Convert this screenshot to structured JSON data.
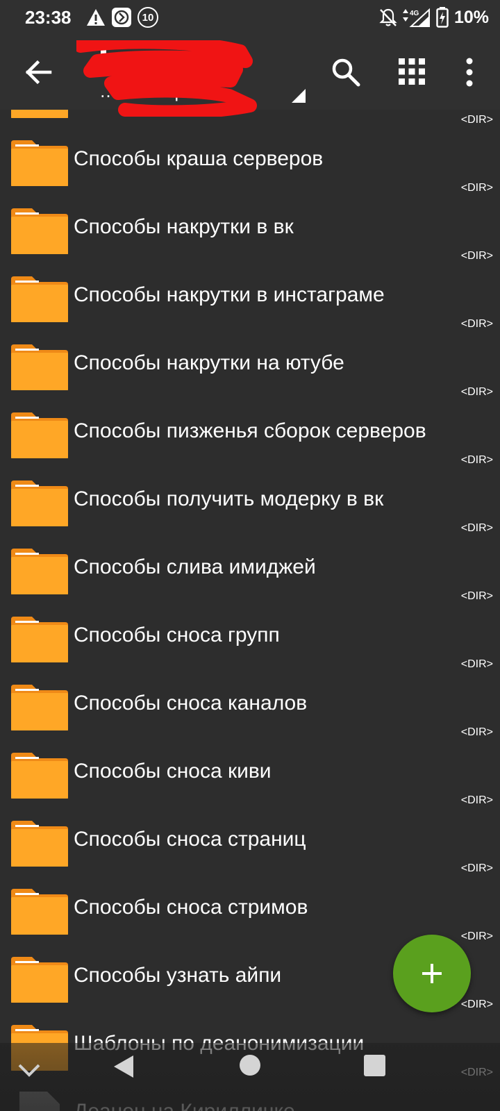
{
  "status_bar": {
    "time": "23:38",
    "battery_percent": "10%",
    "notification_count": "10",
    "network": "4G",
    "left_icons": [
      "warning-icon",
      "app-notification-icon",
      "badge-10-icon"
    ],
    "right_icons": [
      "bell-muted-icon",
      "signal-4g-icon",
      "battery-charging-icon"
    ]
  },
  "app_bar": {
    "subtitle": "…0/            ca.zip",
    "icons": [
      "back-arrow-icon",
      "search-icon",
      "grid-view-icon",
      "more-vertical-icon"
    ]
  },
  "folder_color": "#ffa726",
  "fab_color": "#5aa01e",
  "dir_tag": "<DIR>",
  "items": [
    {
      "name": "",
      "type": "folder",
      "tag": "<DIR>"
    },
    {
      "name": "Способы краша серверов",
      "type": "folder",
      "tag": "<DIR>"
    },
    {
      "name": "Способы накрутки в вк",
      "type": "folder",
      "tag": "<DIR>"
    },
    {
      "name": "Способы накрутки в инстаграме",
      "type": "folder",
      "tag": "<DIR>"
    },
    {
      "name": "Способы накрутки на ютубе",
      "type": "folder",
      "tag": "<DIR>"
    },
    {
      "name": "Способы пизженья сборок серверов",
      "type": "folder",
      "tag": "<DIR>"
    },
    {
      "name": "Способы получить модерку в вк",
      "type": "folder",
      "tag": "<DIR>"
    },
    {
      "name": "Способы слива имиджей",
      "type": "folder",
      "tag": "<DIR>"
    },
    {
      "name": "Способы сноса групп",
      "type": "folder",
      "tag": "<DIR>"
    },
    {
      "name": "Способы сноса каналов",
      "type": "folder",
      "tag": "<DIR>"
    },
    {
      "name": "Способы сноса киви",
      "type": "folder",
      "tag": "<DIR>"
    },
    {
      "name": "Способы сноса страниц",
      "type": "folder",
      "tag": "<DIR>"
    },
    {
      "name": "Способы сноса стримов",
      "type": "folder",
      "tag": "<DIR>"
    },
    {
      "name": "Способы узнать айпи",
      "type": "folder",
      "tag": "<DIR>"
    },
    {
      "name": "Шаблоны по деанонимизации",
      "type": "folder",
      "tag": "<DIR>"
    },
    {
      "name": "Деанон на Кирилличке",
      "type": "file",
      "tag": ""
    }
  ],
  "fab": {
    "icon": "plus-icon"
  },
  "nav_bar": {
    "icons": [
      "collapse-chevron-icon",
      "nav-back-icon",
      "nav-home-icon",
      "nav-recents-icon"
    ]
  }
}
